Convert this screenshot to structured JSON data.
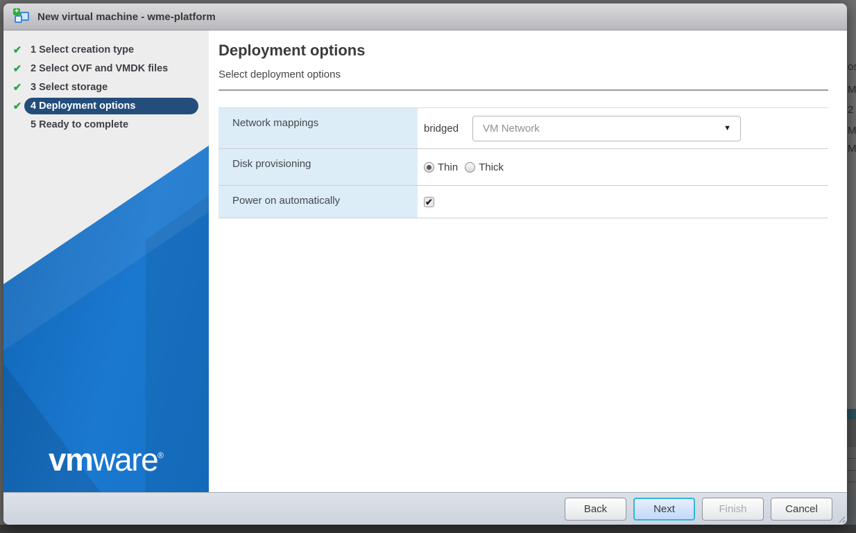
{
  "window": {
    "title": "New virtual machine - wme-platform"
  },
  "icons": {
    "check": "✔",
    "plus": "+",
    "dropdown_arrow": "▼",
    "checkbox_check": "✔"
  },
  "colors": {
    "brand_blue": "#1573c8",
    "active_step_bg": "#234e7c",
    "check_green": "#28a745",
    "label_cell_bg": "#dcedf8",
    "focus_border": "#31b6dc"
  },
  "sidebar": {
    "steps": [
      {
        "label": "1 Select creation type",
        "check": "✔",
        "active": false
      },
      {
        "label": "2 Select OVF and VMDK files",
        "check": "✔",
        "active": false
      },
      {
        "label": "3 Select storage",
        "check": "✔",
        "active": false
      },
      {
        "label": "4 Deployment options",
        "check": "✔",
        "active": true
      },
      {
        "label": "5 Ready to complete",
        "check": "",
        "active": false
      }
    ],
    "logo": {
      "bold": "vm",
      "light": "ware",
      "reg": "®"
    }
  },
  "content": {
    "title": "Deployment options",
    "subtitle": "Select deployment options",
    "rows": {
      "network": {
        "label": "Network mappings",
        "key": "bridged",
        "value": "VM Network"
      },
      "disk": {
        "label": "Disk provisioning",
        "options": [
          {
            "label": "Thin",
            "checked": true
          },
          {
            "label": "Thick",
            "checked": false
          }
        ]
      },
      "power": {
        "label": "Power on automatically",
        "checked": true
      }
    }
  },
  "footer": {
    "buttons": [
      {
        "label": "Back",
        "focused": false,
        "disabled": false
      },
      {
        "label": "Next",
        "focused": true,
        "disabled": false
      },
      {
        "label": "Finish",
        "focused": false,
        "disabled": true
      },
      {
        "label": "Cancel",
        "focused": false,
        "disabled": false
      }
    ]
  },
  "background": {
    "fragments": [
      "os",
      "M",
      "2",
      "M",
      "M"
    ]
  }
}
